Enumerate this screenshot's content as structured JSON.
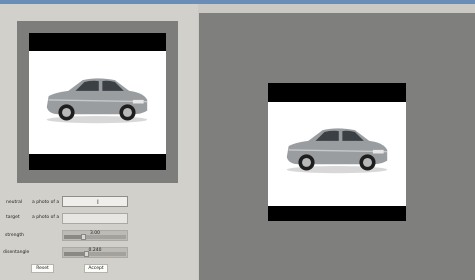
{
  "form": {
    "neutral": {
      "label": "neutral",
      "prefix": "a photo of a",
      "value": ""
    },
    "target": {
      "label": "target",
      "prefix": "a photo of a",
      "value": ""
    },
    "strength": {
      "label": "strength",
      "value_text": "3.00",
      "fraction": 0.3
    },
    "threshold": {
      "label": "disentangle",
      "value_text": "0.240",
      "fraction": 0.35
    }
  },
  "buttons": {
    "reset": "Reset",
    "accept": "Accept"
  },
  "icons": {
    "text_cursor": "I"
  },
  "colors": {
    "panel": "#d2d0cb",
    "canvas": "#7f7f7d",
    "topbar": "#6a8db8"
  }
}
